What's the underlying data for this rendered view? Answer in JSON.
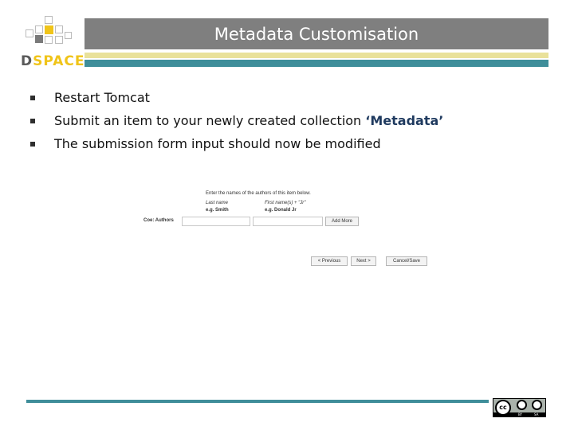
{
  "logo": {
    "text_d": "D",
    "text_space": "SPACE"
  },
  "slide": {
    "title": "Metadata Customisation",
    "bullets": [
      {
        "text": "Restart Tomcat"
      },
      {
        "text": "Submit an item to your newly created collection ",
        "highlight": "‘Metadata’"
      },
      {
        "text": "The submission form input should now be modified"
      }
    ]
  },
  "form": {
    "instruction": "Enter the names of the authors of this item below.",
    "lastname_label": "Last name",
    "lastname_example": "e.g. Smith",
    "firstname_label": "First name(s) + \"Jr\"",
    "firstname_example": "e.g. Donald Jr",
    "field_label": "Coe: Authors",
    "add_more": "Add More",
    "previous": "< Previous",
    "next": "Next >",
    "cancel_save": "Cancel/Save"
  },
  "license": {
    "cc": "cc",
    "by": "BY",
    "sa": "SA"
  },
  "colors": {
    "title_bar": "#7f7f7f",
    "accent_teal": "#3f8e9a",
    "accent_yellow": "#e9e19a",
    "logo_yellow": "#f0c419"
  },
  "icons": [
    "dspace-logo-icon",
    "bullet-square-icon",
    "cc-by-sa-license-icon"
  ]
}
